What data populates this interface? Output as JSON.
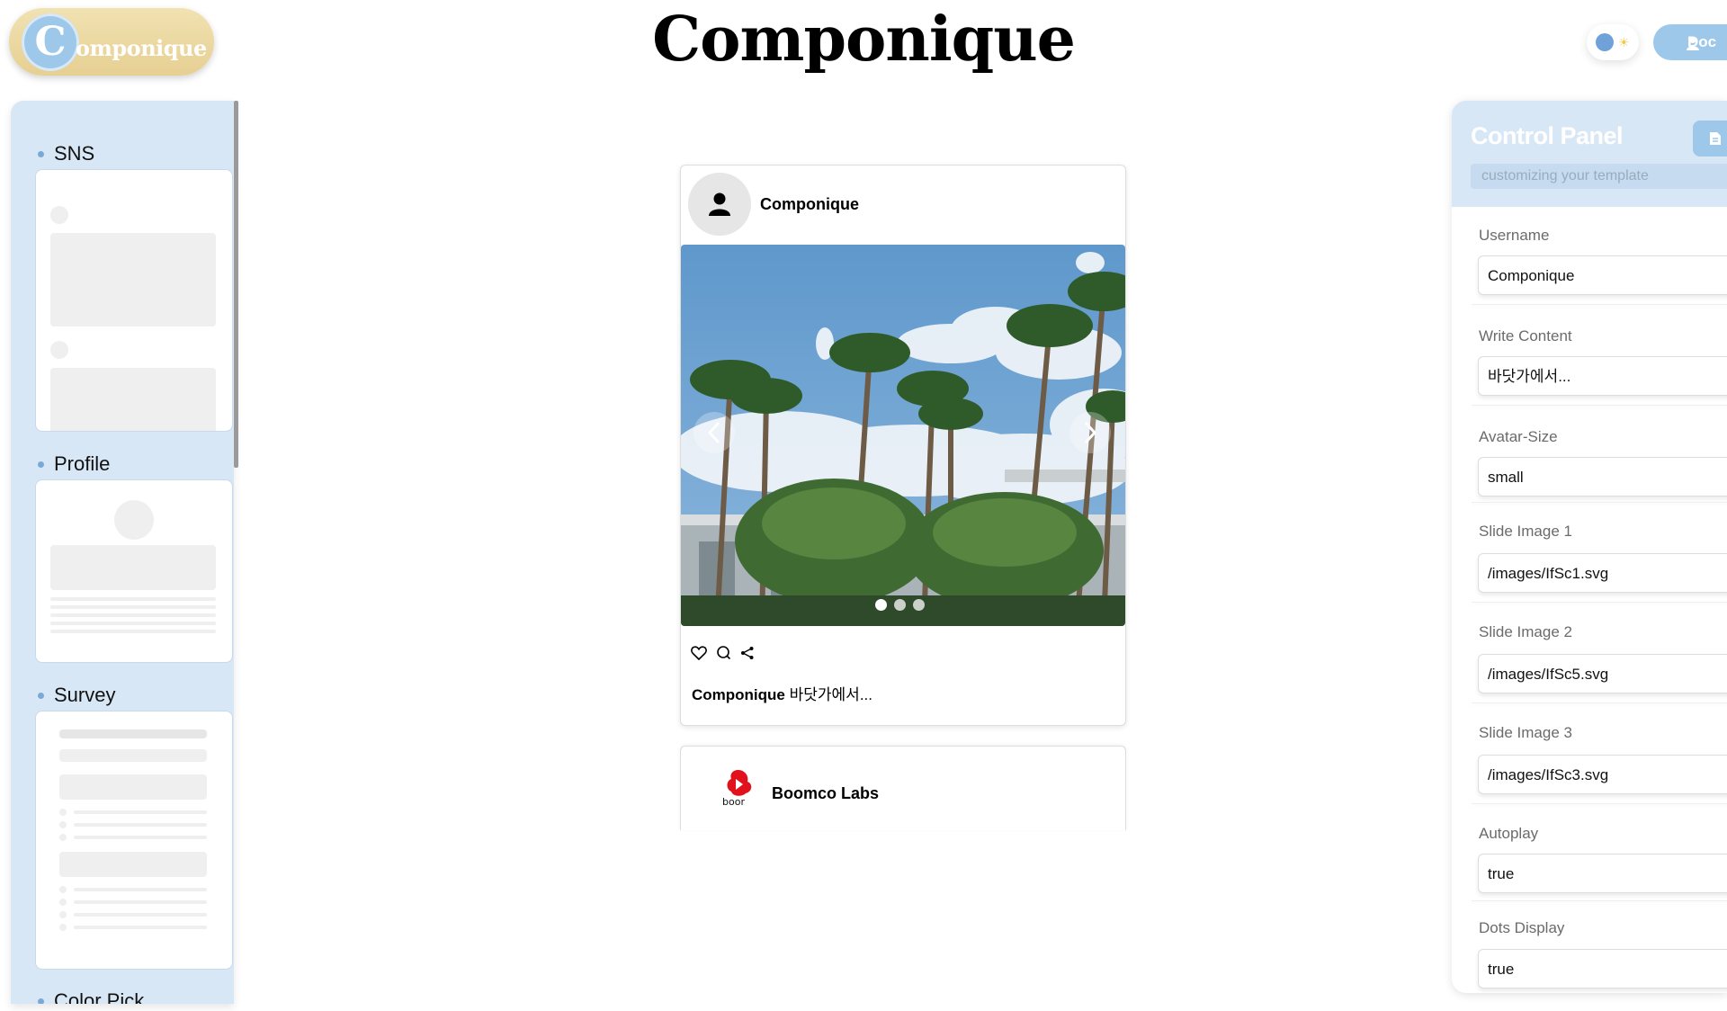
{
  "header": {
    "logo_letter": "C",
    "logo_rest": "omponique",
    "title": "Componique",
    "docs_label": "Doc"
  },
  "sidebar": {
    "sections": [
      {
        "label": "SNS"
      },
      {
        "label": "Profile"
      },
      {
        "label": "Survey"
      },
      {
        "label": "Color Pick"
      }
    ]
  },
  "feed": {
    "post1": {
      "username": "Componique",
      "caption_user": "Componique",
      "caption_text": " 바닷가에서..."
    },
    "post2": {
      "username": "Boomco Labs",
      "logo_text": "boor"
    }
  },
  "control_panel": {
    "title": "Control Panel",
    "subtitle": "customizing your template",
    "fields": [
      {
        "label": "Username",
        "value": "Componique"
      },
      {
        "label": "Write Content",
        "value": "바닷가에서..."
      },
      {
        "label": "Avatar-Size",
        "value": "small"
      },
      {
        "label": "Slide Image 1",
        "value": "/images/IfSc1.svg"
      },
      {
        "label": "Slide Image 2",
        "value": "/images/IfSc5.svg"
      },
      {
        "label": "Slide Image 3",
        "value": "/images/IfSc3.svg"
      },
      {
        "label": "Autoplay",
        "value": "true"
      },
      {
        "label": "Dots Display",
        "value": "true"
      }
    ]
  },
  "slider": {
    "slide_count": 3,
    "active_index": 0
  },
  "colors": {
    "accent": "#9ec8ea",
    "sidebar_bg": "#d8e7f6",
    "logo_gold": "#e6cf92"
  }
}
